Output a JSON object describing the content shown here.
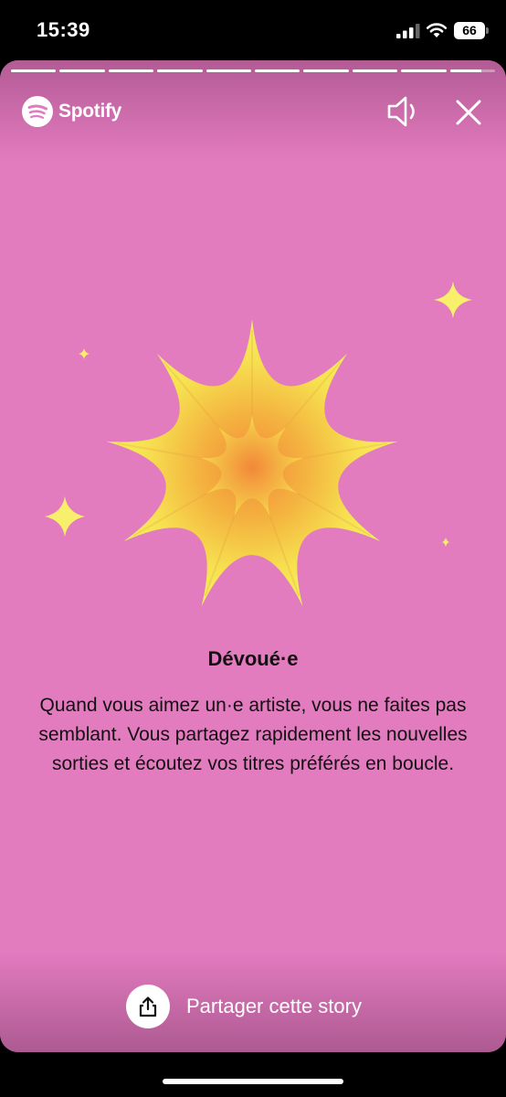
{
  "status_bar": {
    "time": "15:39",
    "battery_level": "66",
    "icons": [
      "signal-icon",
      "wifi-icon",
      "battery-icon"
    ]
  },
  "story": {
    "brand": "Spotify",
    "progress": {
      "total_segments": 10,
      "completed_segments": 9,
      "current_segment_fraction": 0.7
    },
    "controls": [
      "sound-icon",
      "close-icon"
    ],
    "title": "Dévoué·e",
    "description": "Quand vous aimez un·e artiste, vous ne faites pas semblant. Vous partagez rapidement les nouvelles sorties et écoutez vos titres préférés en boucle.",
    "share_label": "Partager cette story",
    "share_icon": "share-icon"
  },
  "colors": {
    "background": "#e37bbf",
    "star_outer": "#f6f25e",
    "star_inner": "#f28a3c",
    "sparkle": "#f8f06a",
    "text": "#111111"
  }
}
